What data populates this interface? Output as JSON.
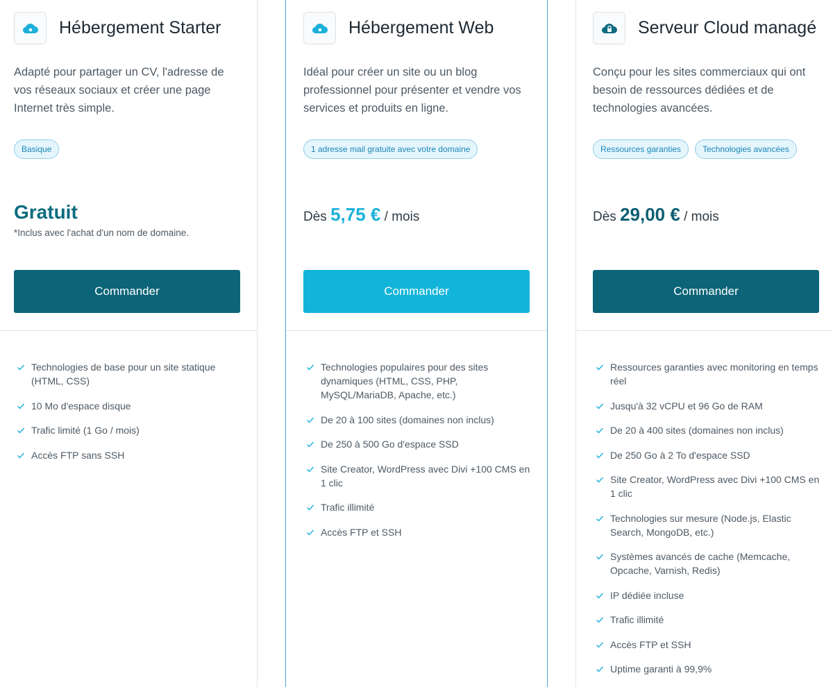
{
  "colors": {
    "brand_dark": "#0c6478",
    "brand_light": "#12b4d9",
    "tag_bg": "#e5f5fc",
    "tag_text": "#1a86b8",
    "check": "#1ab0d9"
  },
  "plans": [
    {
      "icon": "cloud-icon",
      "title": "Hébergement Starter",
      "description": "Adapté pour partager un CV, l'adresse de vos réseaux sociaux et créer une page Internet très simple.",
      "tags": [
        "Basique"
      ],
      "price_label": "Gratuit",
      "price_note": "*Inclus avec l'achat d'un nom de domaine.",
      "button_label": "Commander",
      "features": [
        "Technologies de base pour un site statique (HTML, CSS)",
        "10 Mo d'espace disque",
        "Trafic limité (1 Go / mois)",
        "Accès FTP sans SSH"
      ]
    },
    {
      "icon": "cloud-icon",
      "title": "Hébergement Web",
      "description": "Idéal pour créer un site ou un blog professionnel pour présenter et vendre vos services et produits en ligne.",
      "tags": [
        "1 adresse mail gratuite avec votre domaine"
      ],
      "price_prefix": "Dès",
      "price_amount": "5,75 €",
      "price_suffix": "/ mois",
      "button_label": "Commander",
      "features": [
        "Technologies populaires pour des sites dynamiques (HTML, CSS, PHP, MySQL/MariaDB, Apache, etc.)",
        "De 20 à 100 sites (domaines non inclus)",
        "De 250 à 500 Go d'espace SSD",
        "Site Creator, WordPress avec Divi +100 CMS en 1 clic",
        "Trafic illimité",
        "Accès FTP et SSH"
      ]
    },
    {
      "icon": "cloud-lock-icon",
      "title": "Serveur Cloud managé",
      "description": "Conçu pour les sites commerciaux qui ont besoin de ressources dédiées et de technologies avancées.",
      "tags": [
        "Ressources garanties",
        "Technologies avancées"
      ],
      "price_prefix": "Dès",
      "price_amount": "29,00 €",
      "price_suffix": "/ mois",
      "button_label": "Commander",
      "features": [
        "Ressources garanties avec monitoring en temps réel",
        "Jusqu'à 32 vCPU et 96 Go de RAM",
        "De 20 à 400 sites (domaines non inclus)",
        "De 250 Go à 2 To d'espace SSD",
        "Site Creator, WordPress avec Divi +100 CMS en 1 clic",
        "Technologies sur mesure (Node.js, Elastic Search, MongoDB, etc.)",
        "Systèmes avancés de cache (Memcache, Opcache, Varnish, Redis)",
        "IP dédiée incluse",
        "Trafic illimité",
        "Accès FTP et SSH",
        "Uptime garanti à 99,9%"
      ]
    }
  ]
}
